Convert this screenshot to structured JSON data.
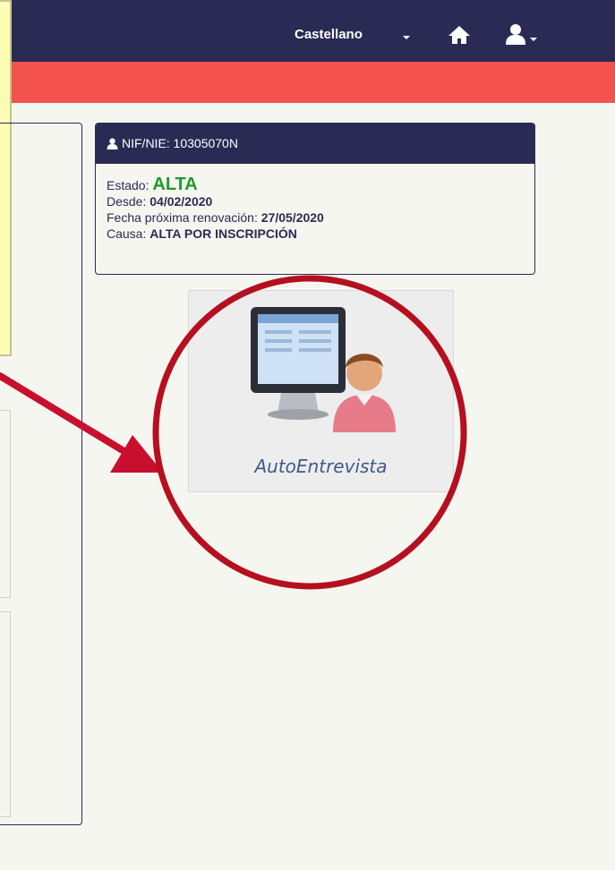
{
  "header": {
    "language": "Castellano"
  },
  "icons": {
    "home": "home-icon",
    "user": "user-icon"
  },
  "nif_card": {
    "title": "NIF/NIE: 10305070N",
    "estado_label": "Estado:",
    "estado_value": "ALTA",
    "desde_label": "Desde:",
    "desde_value": "04/02/2020",
    "renovacion_label": "Fecha próxima renovación:",
    "renovacion_value": "27/05/2020",
    "causa_label": "Causa:",
    "causa_value": "ALTA POR INSCRIPCIÓN"
  },
  "tile": {
    "label": "AutoEntrevista"
  },
  "colors": {
    "navbar": "#2a2b55",
    "accent_bar": "#f4524e",
    "status_ok": "#1e9a2e",
    "annotation": "#c8102e"
  }
}
